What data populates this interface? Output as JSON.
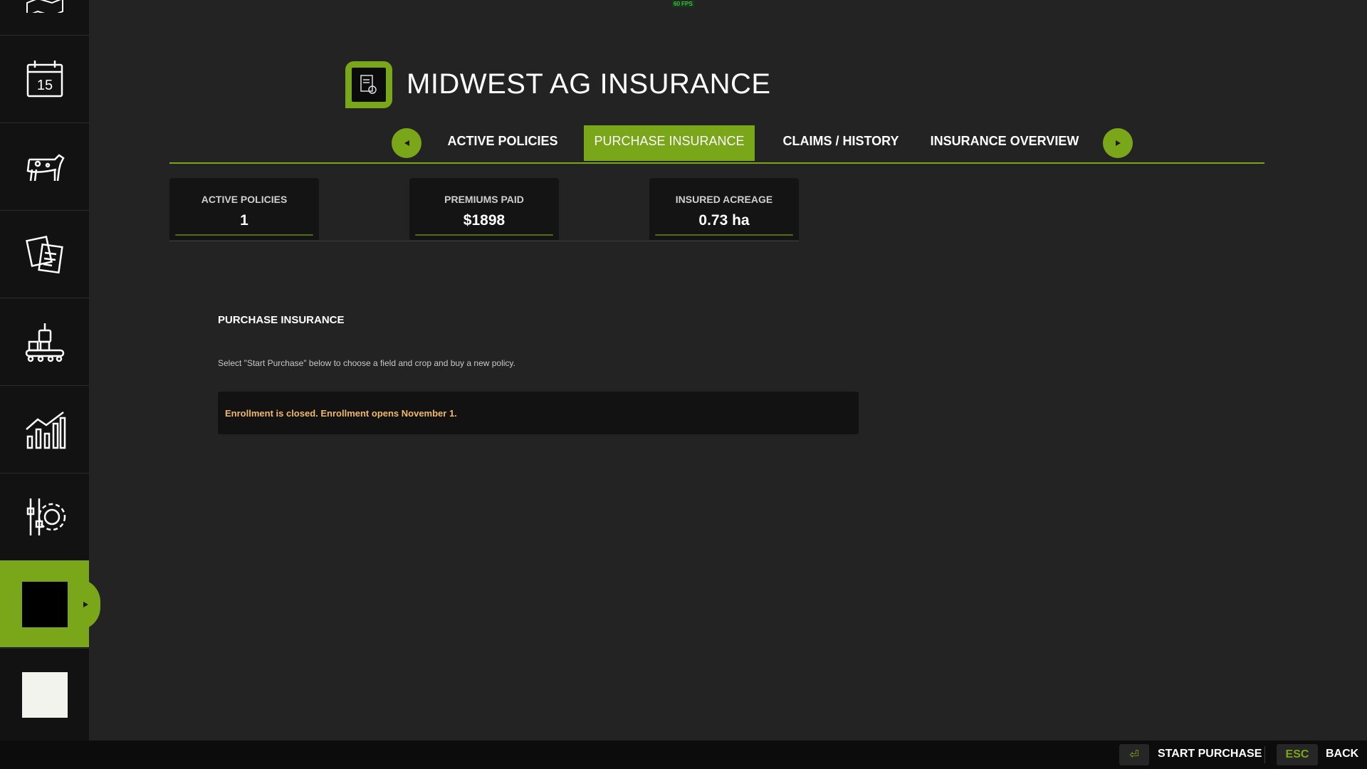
{
  "fps": "60 FPS",
  "header": {
    "title": "MIDWEST AG INSURANCE",
    "logo_icon": "insurance-document-icon"
  },
  "tabs": [
    {
      "label": "ACTIVE POLICIES",
      "active": false
    },
    {
      "label": "PURCHASE INSURANCE",
      "active": true
    },
    {
      "label": "CLAIMS / HISTORY",
      "active": false
    },
    {
      "label": "INSURANCE OVERVIEW",
      "active": false
    }
  ],
  "stats": [
    {
      "label": "ACTIVE POLICIES",
      "value": "1"
    },
    {
      "label": "PREMIUMS PAID",
      "value": "$1898"
    },
    {
      "label": "INSURED ACREAGE",
      "value": "0.73 ha"
    }
  ],
  "section": {
    "title": "PURCHASE INSURANCE",
    "description": "Select \"Start Purchase\" below to choose a field and crop and buy a new policy.",
    "notice": "Enrollment is closed. Enrollment opens November 1."
  },
  "sidebar": {
    "items": [
      {
        "icon": "map-icon"
      },
      {
        "icon": "calendar-icon",
        "day": "15"
      },
      {
        "icon": "cow-icon"
      },
      {
        "icon": "contracts-icon"
      },
      {
        "icon": "production-icon"
      },
      {
        "icon": "statistics-icon"
      },
      {
        "icon": "settings-icon"
      },
      {
        "icon": "insurance-icon",
        "active": true
      },
      {
        "icon": "blank-icon"
      }
    ]
  },
  "bottom_actions": [
    {
      "key": "⏎",
      "label": "START PURCHASE"
    },
    {
      "key": "ESC",
      "label": "BACK"
    }
  ],
  "colors": {
    "accent": "#7aa619",
    "background": "#232323",
    "sidebar": "#121212",
    "notice_text": "#f0b86a"
  }
}
